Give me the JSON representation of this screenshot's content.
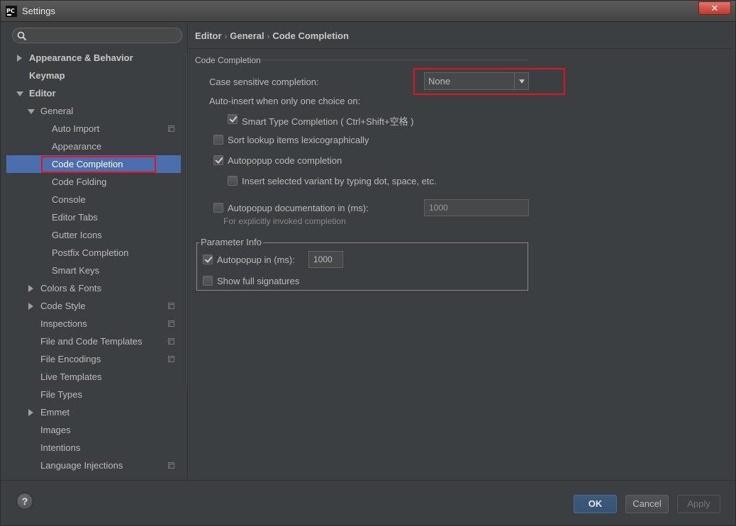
{
  "window": {
    "title": "Settings",
    "app_icon": "PC",
    "close_glyph": "✕"
  },
  "sidebar": {
    "search_placeholder": "",
    "items": [
      {
        "label": "Appearance & Behavior",
        "arrow": "right",
        "bold": true
      },
      {
        "label": "Keymap",
        "arrow": "none",
        "bold": true
      },
      {
        "label": "Editor",
        "arrow": "down",
        "bold": true
      },
      {
        "label": "General",
        "arrow": "down"
      },
      {
        "label": "Auto Import"
      },
      {
        "label": "Appearance"
      },
      {
        "label": "Code Completion",
        "selected": true
      },
      {
        "label": "Code Folding"
      },
      {
        "label": "Console"
      },
      {
        "label": "Editor Tabs"
      },
      {
        "label": "Gutter Icons"
      },
      {
        "label": "Postfix Completion"
      },
      {
        "label": "Smart Keys"
      },
      {
        "label": "Colors & Fonts",
        "arrow": "right"
      },
      {
        "label": "Code Style",
        "arrow": "right"
      },
      {
        "label": "Inspections"
      },
      {
        "label": "File and Code Templates"
      },
      {
        "label": "File Encodings"
      },
      {
        "label": "Live Templates"
      },
      {
        "label": "File Types"
      },
      {
        "label": "Emmet",
        "arrow": "right"
      },
      {
        "label": "Images"
      },
      {
        "label": "Intentions"
      },
      {
        "label": "Language Injections"
      }
    ]
  },
  "breadcrumb": {
    "part1": "Editor",
    "part2": "General",
    "part3": "Code Completion",
    "separator": "›"
  },
  "main": {
    "section_title": "Code Completion",
    "case_sensitive_label": "Case sensitive completion:",
    "case_sensitive_value": "None",
    "auto_insert_label": "Auto-insert when only one choice on:",
    "smart_type_label": "Smart Type Completion ( Ctrl+Shift+空格 )",
    "smart_type_checked": true,
    "sort_lookup_label": "Sort lookup items lexicographically",
    "sort_lookup_checked": false,
    "autopopup_code_label": "Autopopup code completion",
    "autopopup_code_checked": true,
    "insert_selected_label": "Insert selected variant by typing dot, space, etc.",
    "insert_selected_checked": false,
    "autopopup_doc_label": "Autopopup documentation in (ms):",
    "autopopup_doc_checked": false,
    "autopopup_doc_value": "1000",
    "autopopup_doc_hint": "For explicitly invoked completion",
    "param_info_title": "Parameter Info",
    "param_autopopup_label": "Autopopup in (ms):",
    "param_autopopup_checked": true,
    "param_autopopup_value": "1000",
    "show_signatures_label": "Show full signatures",
    "show_signatures_checked": false
  },
  "footer": {
    "help": "?",
    "ok": "OK",
    "cancel": "Cancel",
    "apply": "Apply"
  },
  "colors": {
    "background": "#3c3f41",
    "selection": "#4b6eaf",
    "highlight_box": "#e3141b"
  }
}
